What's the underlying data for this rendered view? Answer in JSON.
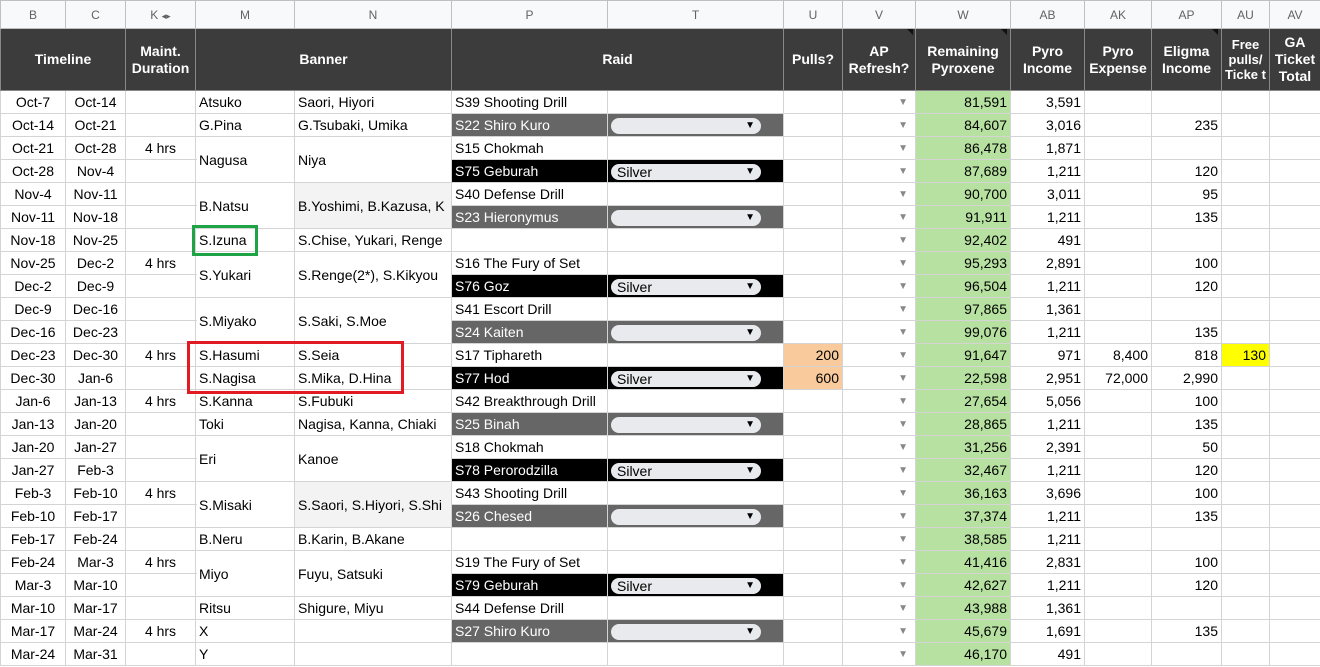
{
  "column_letters": [
    "B",
    "C",
    "K",
    "◂▸",
    "M",
    "N",
    "P",
    "T",
    "U",
    "V",
    "W",
    "AB",
    "AK",
    "AP",
    "AU",
    "AV"
  ],
  "headers": {
    "timeline": "Timeline",
    "maint": "Maint. Duration",
    "banner": "Banner",
    "raid": "Raid",
    "pulls": "Pulls?",
    "ap": "AP Refresh?",
    "remaining": "Remaining Pyroxene",
    "pyro_income": "Pyro Income",
    "pyro_expense": "Pyro Expense",
    "eligma": "Eligma Income",
    "free_pulls": "Free pulls/ Ticke t",
    "ga": "GA Ticket Total"
  },
  "rows": [
    {
      "start": "Oct-7",
      "end": "Oct-14",
      "maint": "",
      "b1": "Atsuko",
      "b2": "Saori, Hiyori",
      "raid": "S39 Shooting Drill",
      "style": "white",
      "diff": "",
      "pulls": "",
      "remaining": "81,591",
      "income": "3,591",
      "expense": "",
      "eligma": "",
      "free": ""
    },
    {
      "start": "Oct-14",
      "end": "Oct-21",
      "maint": "",
      "b1": "G.Pina",
      "b2": "G.Tsubaki, Umika",
      "raid": "S22 Shiro Kuro",
      "style": "grey",
      "diff": "",
      "pulls": "",
      "remaining": "84,607",
      "income": "3,016",
      "expense": "",
      "eligma": "235",
      "free": ""
    },
    {
      "start": "Oct-21",
      "end": "Oct-28",
      "maint": "4 hrs",
      "b1": "Nagusa",
      "b2": "Niya",
      "raid": "S15 Chokmah",
      "style": "white",
      "diff": "",
      "pulls": "",
      "remaining": "86,478",
      "income": "1,871",
      "expense": "",
      "eligma": "",
      "free": ""
    },
    {
      "start": "Oct-28",
      "end": "Nov-4",
      "maint": "",
      "b1": "",
      "b2": "",
      "raid": "S75 Geburah",
      "style": "black",
      "diff": "Silver",
      "pulls": "",
      "remaining": "87,689",
      "income": "1,211",
      "expense": "",
      "eligma": "120",
      "free": ""
    },
    {
      "start": "Nov-4",
      "end": "Nov-11",
      "maint": "",
      "b1": "B.Natsu",
      "b2": "B.Yoshimi, B.Kazusa, K",
      "raid": "S40 Defense Drill",
      "style": "white",
      "diff": "",
      "pulls": "",
      "remaining": "90,700",
      "income": "3,011",
      "expense": "",
      "eligma": "95",
      "free": ""
    },
    {
      "start": "Nov-11",
      "end": "Nov-18",
      "maint": "",
      "b1": "",
      "b2": "",
      "raid": "S23 Hieronymus",
      "style": "grey",
      "diff": "",
      "pulls": "",
      "remaining": "91,911",
      "income": "1,211",
      "expense": "",
      "eligma": "135",
      "free": ""
    },
    {
      "start": "Nov-18",
      "end": "Nov-25",
      "maint": "",
      "b1": "S.Izuna",
      "b2": "S.Chise, Yukari, Renge",
      "raid": "",
      "style": "white",
      "diff": "",
      "pulls": "",
      "remaining": "92,402",
      "income": "491",
      "expense": "",
      "eligma": "",
      "free": ""
    },
    {
      "start": "Nov-25",
      "end": "Dec-2",
      "maint": "4 hrs",
      "b1": "S.Yukari",
      "b2": "S.Renge(2*), S.Kikyou",
      "raid": "S16 The Fury of Set",
      "style": "white",
      "diff": "",
      "pulls": "",
      "remaining": "95,293",
      "income": "2,891",
      "expense": "",
      "eligma": "100",
      "free": ""
    },
    {
      "start": "Dec-2",
      "end": "Dec-9",
      "maint": "",
      "b1": "",
      "b2": "",
      "raid": "S76 Goz",
      "style": "black",
      "diff": "Silver",
      "pulls": "",
      "remaining": "96,504",
      "income": "1,211",
      "expense": "",
      "eligma": "120",
      "free": ""
    },
    {
      "start": "Dec-9",
      "end": "Dec-16",
      "maint": "",
      "b1": "S.Miyako",
      "b2": "S.Saki, S.Moe",
      "raid": "S41 Escort Drill",
      "style": "white",
      "diff": "",
      "pulls": "",
      "remaining": "97,865",
      "income": "1,361",
      "expense": "",
      "eligma": "",
      "free": ""
    },
    {
      "start": "Dec-16",
      "end": "Dec-23",
      "maint": "",
      "b1": "",
      "b2": "",
      "raid": "S24 Kaiten",
      "style": "grey",
      "diff": "",
      "pulls": "",
      "remaining": "99,076",
      "income": "1,211",
      "expense": "",
      "eligma": "135",
      "free": ""
    },
    {
      "start": "Dec-23",
      "end": "Dec-30",
      "maint": "4 hrs",
      "b1": "S.Hasumi",
      "b2": "S.Seia",
      "raid": "S17 Tiphareth",
      "style": "white",
      "diff": "",
      "pulls": "200",
      "remaining": "91,647",
      "income": "971",
      "expense": "8,400",
      "eligma": "818",
      "free": "130"
    },
    {
      "start": "Dec-30",
      "end": "Jan-6",
      "maint": "",
      "b1": "S.Nagisa",
      "b2": "S.Mika, D.Hina",
      "raid": "S77 Hod",
      "style": "black",
      "diff": "Silver",
      "pulls": "600",
      "remaining": "22,598",
      "income": "2,951",
      "expense": "72,000",
      "eligma": "2,990",
      "free": ""
    },
    {
      "start": "Jan-6",
      "end": "Jan-13",
      "maint": "4 hrs",
      "b1": "S.Kanna",
      "b2": "S.Fubuki",
      "raid": "S42 Breakthrough Drill",
      "style": "white",
      "diff": "",
      "pulls": "",
      "remaining": "27,654",
      "income": "5,056",
      "expense": "",
      "eligma": "100",
      "free": ""
    },
    {
      "start": "Jan-13",
      "end": "Jan-20",
      "maint": "",
      "b1": "Toki",
      "b2": "Nagisa, Kanna, Chiaki",
      "raid": "S25 Binah",
      "style": "grey",
      "diff": "",
      "pulls": "",
      "remaining": "28,865",
      "income": "1,211",
      "expense": "",
      "eligma": "135",
      "free": ""
    },
    {
      "start": "Jan-20",
      "end": "Jan-27",
      "maint": "",
      "b1": "Eri",
      "b2": "Kanoe",
      "raid": "S18 Chokmah",
      "style": "white",
      "diff": "",
      "pulls": "",
      "remaining": "31,256",
      "income": "2,391",
      "expense": "",
      "eligma": "50",
      "free": ""
    },
    {
      "start": "Jan-27",
      "end": "Feb-3",
      "maint": "",
      "b1": "",
      "b2": "",
      "raid": "S78 Perorodzilla",
      "style": "black",
      "diff": "Silver",
      "pulls": "",
      "remaining": "32,467",
      "income": "1,211",
      "expense": "",
      "eligma": "120",
      "free": ""
    },
    {
      "start": "Feb-3",
      "end": "Feb-10",
      "maint": "4 hrs",
      "b1": "S.Misaki",
      "b2": "S.Saori, S.Hiyori, S.Shi",
      "raid": "S43 Shooting Drill",
      "style": "white",
      "diff": "",
      "pulls": "",
      "remaining": "36,163",
      "income": "3,696",
      "expense": "",
      "eligma": "100",
      "free": ""
    },
    {
      "start": "Feb-10",
      "end": "Feb-17",
      "maint": "",
      "b1": "",
      "b2": "",
      "raid": "S26 Chesed",
      "style": "grey",
      "diff": "",
      "pulls": "",
      "remaining": "37,374",
      "income": "1,211",
      "expense": "",
      "eligma": "135",
      "free": ""
    },
    {
      "start": "Feb-17",
      "end": "Feb-24",
      "maint": "",
      "b1": "B.Neru",
      "b2": "B.Karin, B.Akane",
      "raid": "",
      "style": "white",
      "diff": "",
      "pulls": "",
      "remaining": "38,585",
      "income": "1,211",
      "expense": "",
      "eligma": "",
      "free": ""
    },
    {
      "start": "Feb-24",
      "end": "Mar-3",
      "maint": "4 hrs",
      "b1": "Miyo",
      "b2": "Fuyu, Satsuki",
      "raid": "S19 The Fury of Set",
      "style": "white",
      "diff": "",
      "pulls": "",
      "remaining": "41,416",
      "income": "2,831",
      "expense": "",
      "eligma": "100",
      "free": ""
    },
    {
      "start": "Mar-3",
      "end": "Mar-10",
      "maint": "",
      "b1": "",
      "b2": "",
      "raid": "S79 Geburah",
      "style": "black",
      "diff": "Silver",
      "pulls": "",
      "remaining": "42,627",
      "income": "1,211",
      "expense": "",
      "eligma": "120",
      "free": ""
    },
    {
      "start": "Mar-10",
      "end": "Mar-17",
      "maint": "",
      "b1": "Ritsu",
      "b2": "Shigure, Miyu",
      "raid": "S44 Defense Drill",
      "style": "white",
      "diff": "",
      "pulls": "",
      "remaining": "43,988",
      "income": "1,361",
      "expense": "",
      "eligma": "",
      "free": ""
    },
    {
      "start": "Mar-17",
      "end": "Mar-24",
      "maint": "4 hrs",
      "b1": "X",
      "b2": "",
      "raid": "S27 Shiro Kuro",
      "style": "grey",
      "diff": "",
      "pulls": "",
      "remaining": "45,679",
      "income": "1,691",
      "expense": "",
      "eligma": "135",
      "free": ""
    },
    {
      "start": "Mar-24",
      "end": "Mar-31",
      "maint": "",
      "b1": "Y",
      "b2": "",
      "raid": "",
      "style": "white",
      "diff": "",
      "pulls": "",
      "remaining": "46,170",
      "income": "491",
      "expense": "",
      "eligma": "",
      "free": ""
    }
  ],
  "icons": {
    "dropdown": "chevron-down-icon"
  }
}
